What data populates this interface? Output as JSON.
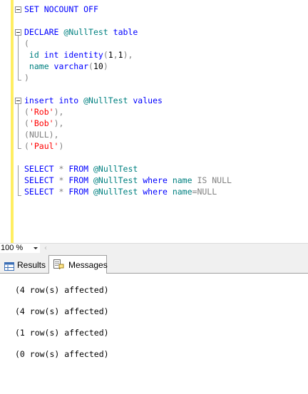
{
  "editor": {
    "lines": [
      [
        {
          "t": "SET",
          "c": "kw"
        },
        {
          "t": " "
        },
        {
          "t": "NOCOUNT",
          "c": "kw"
        },
        {
          "t": " "
        },
        {
          "t": "OFF",
          "c": "kw"
        }
      ],
      [],
      [
        {
          "t": "DECLARE",
          "c": "kw"
        },
        {
          "t": " "
        },
        {
          "t": "@NullTest",
          "c": "ident"
        },
        {
          "t": " "
        },
        {
          "t": "table",
          "c": "kw"
        }
      ],
      [
        {
          "t": "(",
          "c": "op"
        }
      ],
      [
        {
          "t": " id ",
          "c": "ident"
        },
        {
          "t": "int",
          "c": "kw"
        },
        {
          "t": " "
        },
        {
          "t": "identity",
          "c": "kw"
        },
        {
          "t": "(",
          "c": "op"
        },
        {
          "t": "1",
          "c": "blk"
        },
        {
          "t": ",",
          "c": "op"
        },
        {
          "t": "1",
          "c": "blk"
        },
        {
          "t": "),",
          "c": "op"
        }
      ],
      [
        {
          "t": " name ",
          "c": "ident"
        },
        {
          "t": "varchar",
          "c": "kw"
        },
        {
          "t": "(",
          "c": "op"
        },
        {
          "t": "10",
          "c": "blk"
        },
        {
          "t": ")",
          "c": "op"
        }
      ],
      [
        {
          "t": ")",
          "c": "op"
        }
      ],
      [],
      [
        {
          "t": "insert",
          "c": "kw"
        },
        {
          "t": " "
        },
        {
          "t": "into",
          "c": "kw"
        },
        {
          "t": " "
        },
        {
          "t": "@NullTest",
          "c": "ident"
        },
        {
          "t": " "
        },
        {
          "t": "values",
          "c": "kw"
        }
      ],
      [
        {
          "t": "(",
          "c": "op"
        },
        {
          "t": "'Rob'",
          "c": "str"
        },
        {
          "t": "),",
          "c": "op"
        }
      ],
      [
        {
          "t": "(",
          "c": "op"
        },
        {
          "t": "'Bob'",
          "c": "str"
        },
        {
          "t": "),",
          "c": "op"
        }
      ],
      [
        {
          "t": "(",
          "c": "op"
        },
        {
          "t": "NULL",
          "c": "op"
        },
        {
          "t": "),",
          "c": "op"
        }
      ],
      [
        {
          "t": "(",
          "c": "op"
        },
        {
          "t": "'Paul'",
          "c": "str"
        },
        {
          "t": ")",
          "c": "op"
        }
      ],
      [],
      [
        {
          "t": "SELECT",
          "c": "kw"
        },
        {
          "t": " "
        },
        {
          "t": "*",
          "c": "op"
        },
        {
          "t": " "
        },
        {
          "t": "FROM",
          "c": "kw"
        },
        {
          "t": " "
        },
        {
          "t": "@NullTest",
          "c": "ident"
        }
      ],
      [
        {
          "t": "SELECT",
          "c": "kw"
        },
        {
          "t": " "
        },
        {
          "t": "*",
          "c": "op"
        },
        {
          "t": " "
        },
        {
          "t": "FROM",
          "c": "kw"
        },
        {
          "t": " "
        },
        {
          "t": "@NullTest",
          "c": "ident"
        },
        {
          "t": " "
        },
        {
          "t": "where",
          "c": "kw"
        },
        {
          "t": " "
        },
        {
          "t": "name",
          "c": "ident"
        },
        {
          "t": " "
        },
        {
          "t": "IS",
          "c": "op"
        },
        {
          "t": " "
        },
        {
          "t": "NULL",
          "c": "op"
        }
      ],
      [
        {
          "t": "SELECT",
          "c": "kw"
        },
        {
          "t": " "
        },
        {
          "t": "*",
          "c": "op"
        },
        {
          "t": " "
        },
        {
          "t": "FROM",
          "c": "kw"
        },
        {
          "t": " "
        },
        {
          "t": "@NullTest",
          "c": "ident"
        },
        {
          "t": " "
        },
        {
          "t": "where",
          "c": "kw"
        },
        {
          "t": " "
        },
        {
          "t": "name",
          "c": "ident"
        },
        {
          "t": "=",
          "c": "op"
        },
        {
          "t": "NULL",
          "c": "op"
        }
      ]
    ]
  },
  "zoom": {
    "value": "100 %"
  },
  "tabs": {
    "results_label": "Results",
    "messages_label": "Messages"
  },
  "messages": [
    "(4 row(s) affected)",
    "(4 row(s) affected)",
    "(1 row(s) affected)",
    "(0 row(s) affected)"
  ]
}
